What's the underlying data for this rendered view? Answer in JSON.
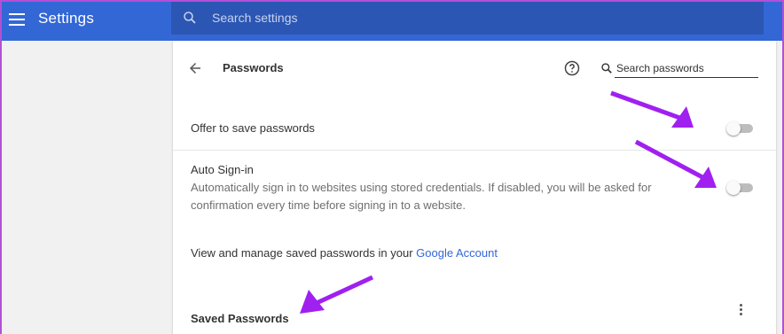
{
  "header": {
    "title": "Settings",
    "search_placeholder": "Search settings"
  },
  "passwords_page": {
    "title": "Passwords",
    "search_placeholder": "Search passwords",
    "offer_to_save": {
      "label": "Offer to save passwords",
      "enabled": false
    },
    "auto_signin": {
      "label": "Auto Sign-in",
      "description": "Automatically sign in to websites using stored credentials. If disabled, you will be asked for confirmation every time before signing in to a website.",
      "enabled": false
    },
    "manage_text": "View and manage saved passwords in your ",
    "manage_link": "Google Account",
    "saved_passwords_heading": "Saved Passwords"
  },
  "colors": {
    "header_bg": "#3367d6",
    "search_bg": "#2c56b3",
    "link": "#3367d6",
    "annotation_arrow": "#a020f0"
  },
  "icons": {
    "menu": "hamburger-menu-icon",
    "search": "search-icon",
    "back": "back-arrow-icon",
    "help": "help-circle-icon",
    "more": "more-vert-icon"
  }
}
